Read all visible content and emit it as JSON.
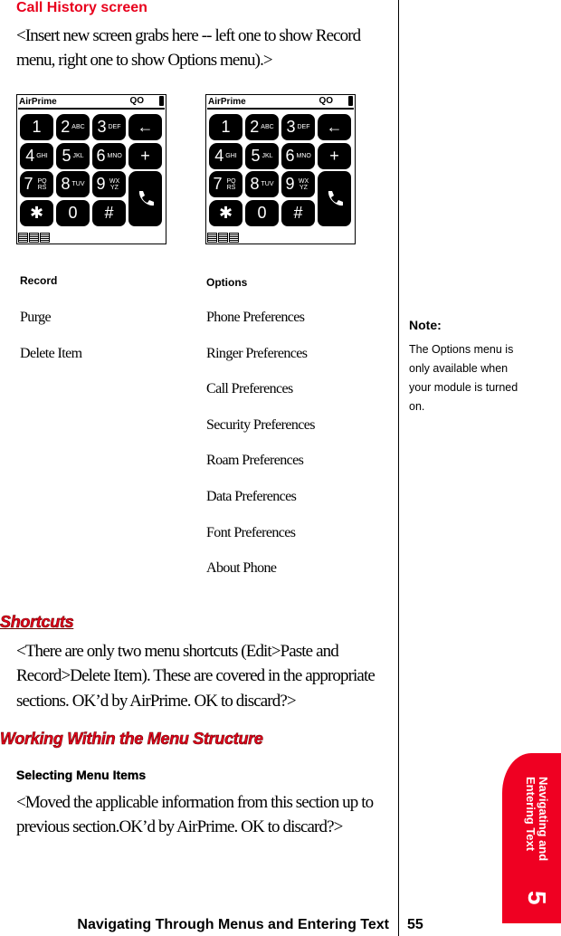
{
  "section_heading": "Call History screen",
  "intro_lines": [
    "<Insert new screen grabs here -- left one to show Record",
    "menu, right one to show Options menu).>"
  ],
  "phone_screen": {
    "title": "AirPrime",
    "voicemail_glyph": "QO",
    "keys": [
      {
        "main": "1",
        "sub": ""
      },
      {
        "main": "2",
        "sub": "ABC"
      },
      {
        "main": "3",
        "sub": "DEF"
      },
      {
        "main": "←",
        "sub": ""
      },
      {
        "main": "4",
        "sub": "GHI"
      },
      {
        "main": "5",
        "sub": "JKL"
      },
      {
        "main": "6",
        "sub": "MNO"
      },
      {
        "main": "+",
        "sub": ""
      },
      {
        "main": "7",
        "sub": "PQ RS"
      },
      {
        "main": "8",
        "sub": "TUV"
      },
      {
        "main": "9",
        "sub": "WX YZ"
      },
      {
        "main": "✱",
        "sub": ""
      },
      {
        "main": "0",
        "sub": ""
      },
      {
        "main": "#",
        "sub": ""
      }
    ],
    "call_key_icon": "phone-handset-icon"
  },
  "record_menu": {
    "heading": "Record",
    "items": [
      "Purge",
      "Delete Item"
    ]
  },
  "options_menu": {
    "heading": "Options",
    "items": [
      "Phone Preferences",
      "Ringer Preferences",
      "Call Preferences",
      "Security Preferences",
      "Roam Preferences",
      "Data Preferences",
      "Font Preferences",
      "About Phone"
    ]
  },
  "note": {
    "heading": "Note:",
    "text": "The Options menu is only available when your module is turned on."
  },
  "shortcuts": {
    "heading": "Shortcuts",
    "lines": [
      "<There are only two menu shortcuts (Edit>Paste and",
      "Record>Delete Item). These are covered in the appropriate",
      "sections. OK’d by AirPrime. OK to discard?>"
    ]
  },
  "working": {
    "heading": "Working Within the Menu Structure",
    "subheading": "Selecting Menu Items",
    "lines": [
      "<Moved the applicable information from this section up to",
      "previous section.OK’d by AirPrime. OK to discard?>"
    ]
  },
  "chapter_tab": {
    "label_line1": "Navigating and",
    "label_line2": "Entering Text",
    "number": "5",
    "color": "#ef0022"
  },
  "footer": {
    "title": "Navigating Through Menus and Entering Text",
    "page": "55"
  },
  "accent_color": "#e8001c"
}
